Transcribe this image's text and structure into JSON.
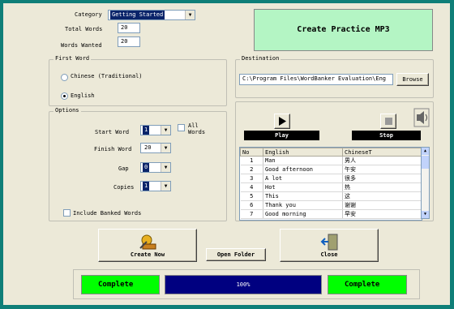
{
  "form": {
    "category_label": "Category",
    "category_value": "Getting Started",
    "total_words_label": "Total Words",
    "total_words_value": "20",
    "words_wanted_label": "Words Wanted",
    "words_wanted_value": "20"
  },
  "first_word": {
    "group_label": "First Word",
    "option_chinese": "Chinese (Traditional)",
    "option_english": "English",
    "selected": "English"
  },
  "options": {
    "group_label": "Options",
    "start_word_label": "Start Word",
    "start_word_value": "1",
    "all_words_label_1": "All",
    "all_words_label_2": "Words",
    "finish_word_label": "Finish Word",
    "finish_word_value": "20",
    "gap_label": "Gap",
    "gap_value": "0",
    "copies_label": "Copies",
    "copies_value": "1",
    "include_banked_label": "Include Banked Words"
  },
  "create_mp3": {
    "label": "Create Practice MP3"
  },
  "destination": {
    "group_label": "Destination",
    "path": "C:\\Program Files\\WordBanker Evaluation\\Eng",
    "browse_label": "Browse"
  },
  "player": {
    "play_label": "Play",
    "stop_label": "Stop"
  },
  "word_list": {
    "headers": [
      "No",
      "English",
      "ChineseT"
    ],
    "rows": [
      [
        "1",
        "Man",
        "男人"
      ],
      [
        "2",
        "Good afternoon",
        "午安"
      ],
      [
        "3",
        "A lot",
        "很多"
      ],
      [
        "4",
        "Hot",
        "热"
      ],
      [
        "5",
        "This",
        "这"
      ],
      [
        "6",
        "Thank you",
        "谢谢"
      ],
      [
        "7",
        "Good morning",
        "早安"
      ]
    ]
  },
  "actions": {
    "create_now_label": "Create Now",
    "open_folder_label": "Open Folder",
    "close_label": "Close"
  },
  "status_bar": {
    "left_status": "Complete",
    "progress_text": "100%",
    "progress_value": 1.0,
    "right_status": "Complete"
  },
  "colors": {
    "frame": "#0f7f78",
    "create_mp3_bg": "#b4f5c4",
    "status_green": "#00ff00",
    "progress_blue": "#000080"
  }
}
